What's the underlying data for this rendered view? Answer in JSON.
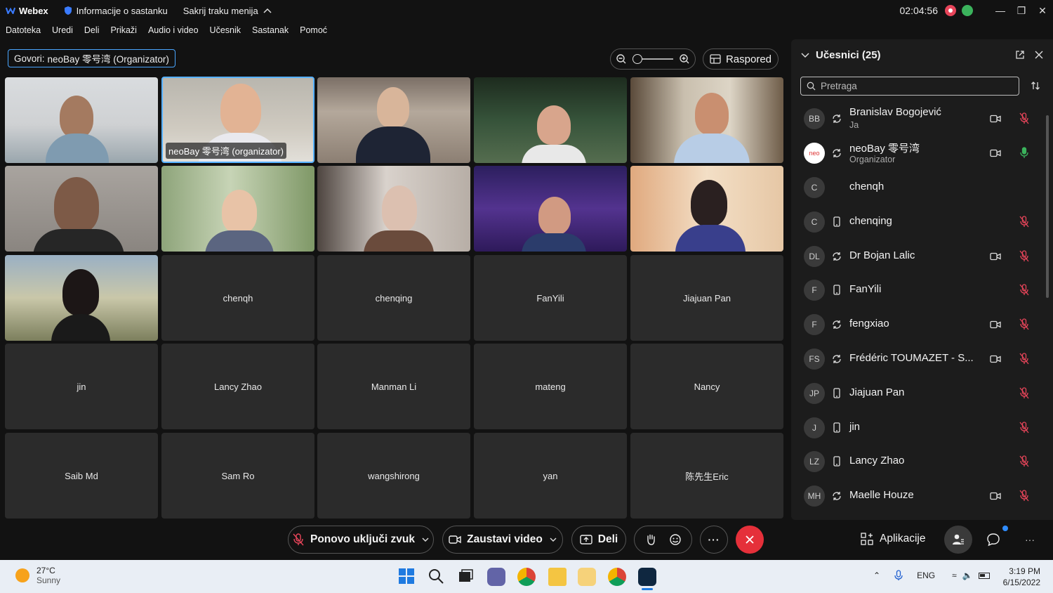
{
  "titlebar": {
    "app_name": "Webex",
    "meeting_info": "Informacije o sastanku",
    "hide_menu": "Sakrij traku menija",
    "timer": "02:04:56"
  },
  "menu": [
    "Datoteka",
    "Uredi",
    "Deli",
    "Prikaži",
    "Audio i video",
    "Učesnik",
    "Sastanak",
    "Pomoć"
  ],
  "speaker_label": "Govori:",
  "speaker_name": "neoBay 零号湾 (Organizator)",
  "layout_button": "Raspored",
  "video_tiles": [
    {
      "name": ""
    },
    {
      "name": "neoBay 零号湾 (organizator)"
    },
    {
      "name": ""
    },
    {
      "name": ""
    },
    {
      "name": ""
    },
    {
      "name": ""
    },
    {
      "name": ""
    },
    {
      "name": ""
    },
    {
      "name": ""
    },
    {
      "name": ""
    },
    {
      "name": ""
    }
  ],
  "name_tiles": [
    "chenqh",
    "chenqing",
    "FanYili",
    "Jiajuan Pan",
    "jin",
    "Lancy Zhao",
    "Manman Li",
    "mateng",
    "Nancy",
    "Saib Md",
    "Sam Ro",
    "wangshirong",
    "yan",
    "陈先生Eric"
  ],
  "participants_panel": {
    "title": "Učesnici (25)",
    "search_placeholder": "Pretraga",
    "items": [
      {
        "initials": "BB",
        "name": "Branislav Bogojević",
        "sub": "Ja",
        "device": "sync",
        "cam": true,
        "mic": "muted"
      },
      {
        "initials": "neo",
        "name": "neoBay 零号湾",
        "sub": "Organizator",
        "device": "sync",
        "cam": true,
        "mic": "active"
      },
      {
        "initials": "C",
        "name": "chenqh",
        "sub": "",
        "device": "",
        "cam": false,
        "mic": ""
      },
      {
        "initials": "C",
        "name": "chenqing",
        "sub": "",
        "device": "phone",
        "cam": false,
        "mic": "muted"
      },
      {
        "initials": "DL",
        "name": "Dr Bojan Lalic",
        "sub": "",
        "device": "sync",
        "cam": true,
        "mic": "muted"
      },
      {
        "initials": "F",
        "name": "FanYili",
        "sub": "",
        "device": "phone",
        "cam": false,
        "mic": "muted"
      },
      {
        "initials": "F",
        "name": "fengxiao",
        "sub": "",
        "device": "sync",
        "cam": true,
        "mic": "muted"
      },
      {
        "initials": "FS",
        "name": "Frédéric TOUMAZET - S...",
        "sub": "",
        "device": "sync",
        "cam": true,
        "mic": "muted"
      },
      {
        "initials": "JP",
        "name": "Jiajuan Pan",
        "sub": "",
        "device": "phone",
        "cam": false,
        "mic": "muted"
      },
      {
        "initials": "J",
        "name": "jin",
        "sub": "",
        "device": "phone",
        "cam": false,
        "mic": "muted"
      },
      {
        "initials": "LZ",
        "name": "Lancy Zhao",
        "sub": "",
        "device": "phone",
        "cam": false,
        "mic": "muted"
      },
      {
        "initials": "MH",
        "name": "Maelle Houze",
        "sub": "",
        "device": "sync",
        "cam": true,
        "mic": "muted"
      }
    ]
  },
  "controls": {
    "unmute": "Ponovo uključi zvuk",
    "stop_video": "Zaustavi video",
    "share": "Deli",
    "apps": "Aplikacije"
  },
  "taskbar": {
    "temp": "27°C",
    "weather": "Sunny",
    "lang": "ENG",
    "time": "3:19 PM",
    "date": "6/15/2022"
  },
  "colors": {
    "accent": "#4aa6ff",
    "end_call": "#e5303a",
    "muted_mic": "#e8455a",
    "active_mic": "#3bb35c"
  }
}
